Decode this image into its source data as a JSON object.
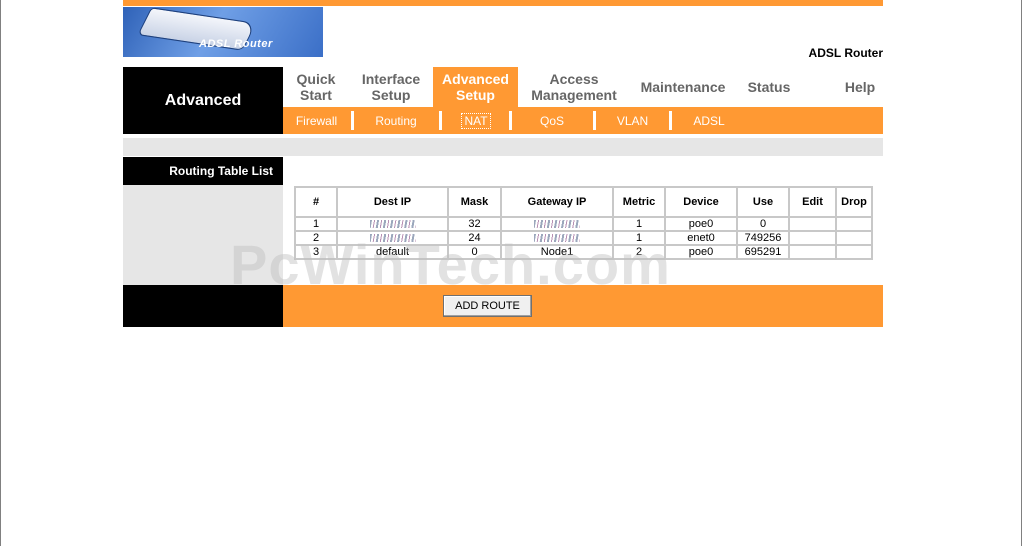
{
  "logo": {
    "label": "ADSL Router"
  },
  "brand_title": "ADSL Router",
  "section_title": "Advanced",
  "main_tabs": [
    {
      "label": "Quick\nStart",
      "active": false
    },
    {
      "label": "Interface\nSetup",
      "active": false
    },
    {
      "label": "Advanced\nSetup",
      "active": true
    },
    {
      "label": "Access\nManagement",
      "active": false
    },
    {
      "label": "Maintenance",
      "active": false
    },
    {
      "label": "Status",
      "active": false
    },
    {
      "label": "Help",
      "active": false
    }
  ],
  "sub_tabs": [
    {
      "label": "Firewall",
      "active": false
    },
    {
      "label": "Routing",
      "active": false
    },
    {
      "label": "NAT",
      "active": true
    },
    {
      "label": "QoS",
      "active": false
    },
    {
      "label": "VLAN",
      "active": false
    },
    {
      "label": "ADSL",
      "active": false
    }
  ],
  "routing": {
    "heading": "Routing Table List",
    "columns": [
      "#",
      "Dest IP",
      "Mask",
      "Gateway IP",
      "Metric",
      "Device",
      "Use",
      "Edit",
      "Drop"
    ],
    "rows": [
      {
        "num": "1",
        "dest": "",
        "mask": "32",
        "gateway": "",
        "metric": "1",
        "device": "poe0",
        "use": "0",
        "edit": "",
        "drop": ""
      },
      {
        "num": "2",
        "dest": "",
        "mask": "24",
        "gateway": "",
        "metric": "1",
        "device": "enet0",
        "use": "749256",
        "edit": "",
        "drop": ""
      },
      {
        "num": "3",
        "dest": "default",
        "mask": "0",
        "gateway": "Node1",
        "metric": "2",
        "device": "poe0",
        "use": "695291",
        "edit": "",
        "drop": ""
      }
    ],
    "add_button": "ADD ROUTE"
  },
  "watermark": "PcWinTech.com",
  "colors": {
    "accent": "#ff9933",
    "sidebar": "#000000",
    "band": "#e6e6e6"
  }
}
